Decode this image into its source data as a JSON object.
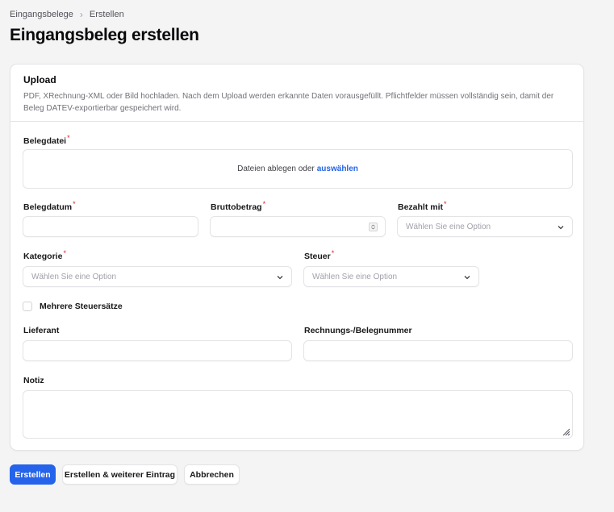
{
  "breadcrumb": {
    "items": [
      "Eingangsbelege",
      "Erstellen"
    ],
    "separator": "›"
  },
  "page_title": "Eingangsbeleg erstellen",
  "upload_section": {
    "title": "Upload",
    "description": "PDF, XRechnung-XML oder Bild hochladen. Nach dem Upload werden erkannte Daten vorausgefüllt. Pflichtfelder müssen vollständig sein, damit der Beleg DATEV-exportierbar gespeichert wird."
  },
  "form": {
    "belegdatei": {
      "label": "Belegdatei",
      "required": "*",
      "drop_text": "Dateien ablegen oder",
      "drop_link": "auswählen"
    },
    "belegdatum": {
      "label": "Belegdatum",
      "required": "*",
      "value": ""
    },
    "bruttobetrag": {
      "label": "Bruttobetrag",
      "required": "*",
      "value": ""
    },
    "bezahlt_mit": {
      "label": "Bezahlt mit",
      "required": "*",
      "placeholder": "Wählen Sie eine Option"
    },
    "kategorie": {
      "label": "Kategorie",
      "required": "*",
      "placeholder": "Wählen Sie eine Option"
    },
    "steuer": {
      "label": "Steuer",
      "required": "*",
      "placeholder": "Wählen Sie eine Option"
    },
    "mehrere_steuersaetze": {
      "label": "Mehrere Steuersätze",
      "checked": false
    },
    "lieferant": {
      "label": "Lieferant",
      "value": ""
    },
    "rechnungsnummer": {
      "label": "Rechnungs-/Belegnummer",
      "value": ""
    },
    "notiz": {
      "label": "Notiz",
      "value": ""
    }
  },
  "actions": {
    "create": "Erstellen",
    "create_another": "Erstellen & weiterer Eintrag",
    "cancel": "Abbrechen"
  },
  "colors": {
    "primary": "#2563eb",
    "required": "#dc2626",
    "background": "#f4f4f5",
    "border": "#e4e4e7"
  },
  "icons": {
    "breadcrumb_separator": "chevron-right-icon",
    "select": "chevron-down-icon",
    "stepper": "number-stepper-icon",
    "textarea_resize": "resize-handle-icon"
  }
}
